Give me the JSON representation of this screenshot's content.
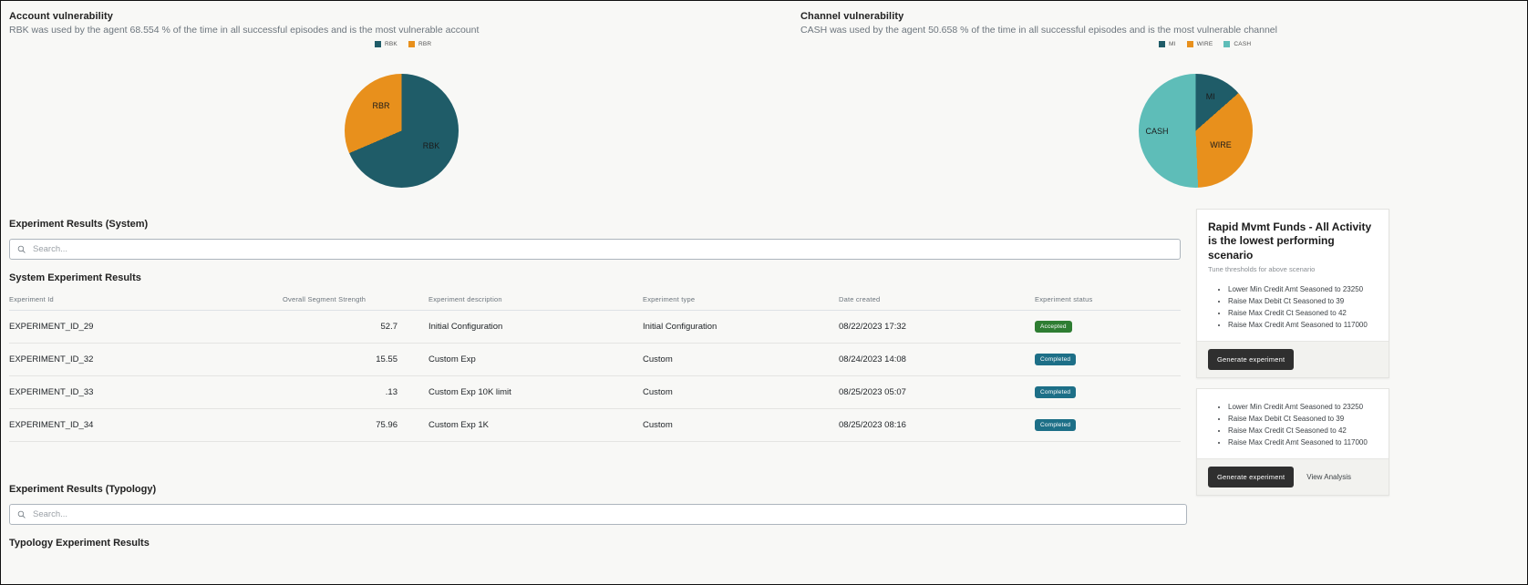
{
  "account_panel": {
    "title": "Account vulnerability",
    "subtitle": "RBK was used by the agent 68.554 % of the time in all successful episodes and is the most vulnerable account",
    "legend": [
      {
        "label": "RBK",
        "color": "#1f5c68"
      },
      {
        "label": "RBR",
        "color": "#e8901c"
      }
    ]
  },
  "channel_panel": {
    "title": "Channel vulnerability",
    "subtitle": "CASH was used by the agent 50.658 % of the time in all successful episodes and is the most vulnerable channel",
    "legend": [
      {
        "label": "MI",
        "color": "#1f5c68"
      },
      {
        "label": "WIRE",
        "color": "#e8901c"
      },
      {
        "label": "CASH",
        "color": "#5ebdb8"
      }
    ]
  },
  "chart_data": [
    {
      "type": "pie",
      "title": "Account vulnerability",
      "labels": [
        "RBK",
        "RBR"
      ],
      "values": [
        68.554,
        31.446
      ],
      "colors": [
        "#1f5c68",
        "#e8901c"
      ],
      "legend_position": "top-right",
      "slice_labels_shown": [
        "RBK",
        "RBR"
      ]
    },
    {
      "type": "pie",
      "title": "Channel vulnerability",
      "labels": [
        "MI",
        "WIRE",
        "CASH"
      ],
      "values": [
        13.5,
        35.8,
        50.658
      ],
      "colors": [
        "#1f5c68",
        "#e8901c",
        "#5ebdb8"
      ],
      "legend_position": "top-right",
      "slice_labels_shown": [
        "MI",
        "WIRE",
        "CASH"
      ]
    }
  ],
  "system_section": {
    "heading": "Experiment Results (System)",
    "search_placeholder": "Search...",
    "search_value": "",
    "table_caption": "System Experiment Results",
    "columns": [
      "Experiment Id",
      "Overall Segment Strength",
      "Experiment description",
      "Experiment type",
      "Date created",
      "Experiment status"
    ],
    "rows": [
      {
        "id": "EXPERIMENT_ID_29",
        "strength": "52.7",
        "description": "Initial Configuration",
        "type": "Initial Configuration",
        "created": "08/22/2023 17:32",
        "status": "Accepted",
        "status_kind": "accepted"
      },
      {
        "id": "EXPERIMENT_ID_32",
        "strength": "15.55",
        "description": "Custom Exp",
        "type": "Custom",
        "created": "08/24/2023 14:08",
        "status": "Completed",
        "status_kind": "completed"
      },
      {
        "id": "EXPERIMENT_ID_33",
        "strength": ".13",
        "description": "Custom Exp 10K limit",
        "type": "Custom",
        "created": "08/25/2023 05:07",
        "status": "Completed",
        "status_kind": "completed"
      },
      {
        "id": "EXPERIMENT_ID_34",
        "strength": "75.96",
        "description": "Custom Exp 1K",
        "type": "Custom",
        "created": "08/25/2023 08:16",
        "status": "Completed",
        "status_kind": "completed"
      }
    ]
  },
  "typology_section": {
    "heading": "Experiment Results (Typology)",
    "search_placeholder": "Search...",
    "search_value": "",
    "table_caption": "Typology Experiment Results"
  },
  "scenario_card": {
    "title": "Rapid Mvmt Funds - All Activity is the lowest performing scenario",
    "subtitle": "Tune thresholds for above scenario",
    "recommendations": [
      "Lower Min Credit Amt Seasoned to 23250",
      "Raise Max Debit Ct Seasoned to 39",
      "Raise Max Credit Ct Seasoned to 42",
      "Raise Max Credit Amt Seasoned to 117000"
    ],
    "generate_label": "Generate experiment"
  },
  "analysis_card": {
    "recommendations": [
      "Lower Min Credit Amt Seasoned to 23250",
      "Raise Max Debit Ct Seasoned to 39",
      "Raise Max Credit Ct Seasoned to 42",
      "Raise Max Credit Amt Seasoned to 117000"
    ],
    "generate_label": "Generate experiment",
    "view_analysis_label": "View Analysis"
  },
  "icons": {
    "search": "search-icon"
  }
}
